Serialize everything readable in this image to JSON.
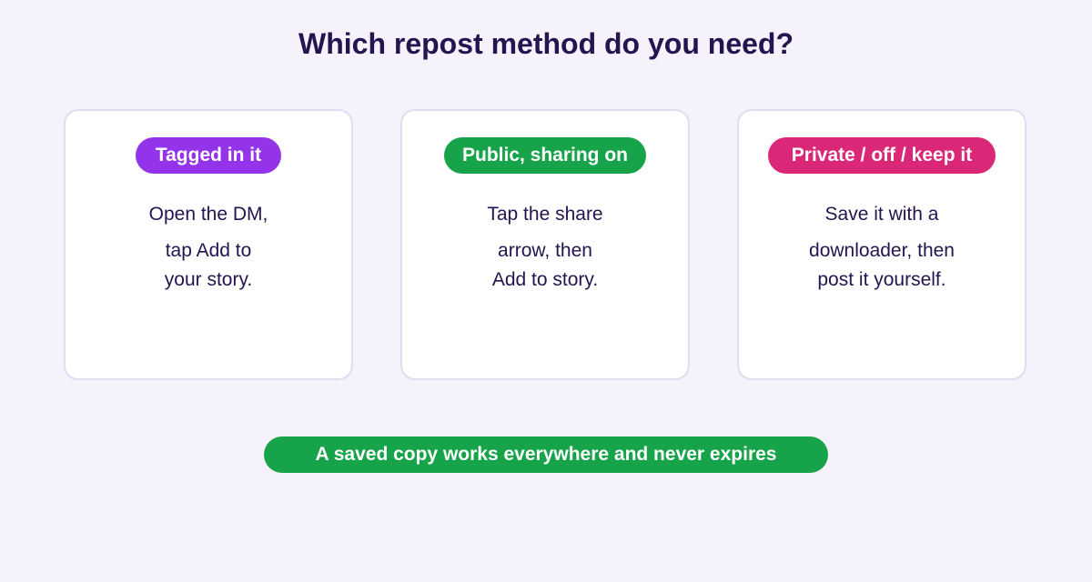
{
  "title": "Which repost method do you need?",
  "colors": {
    "background": "#f5f2fc",
    "text": "#24144f",
    "card_border": "#e2dcf2",
    "tagged": "#9333ea",
    "public": "#16a34a",
    "private": "#db2777",
    "footer": "#16a34a"
  },
  "cards": [
    {
      "label": "Tagged in it",
      "lines": [
        "Open the DM,",
        "tap Add to",
        "your story."
      ]
    },
    {
      "label": "Public, sharing on",
      "lines": [
        "Tap the share",
        "arrow, then",
        "Add to story."
      ]
    },
    {
      "label": "Private / off / keep it",
      "lines": [
        "Save it with a",
        "downloader, then",
        "post it yourself."
      ]
    }
  ],
  "footer": "A saved copy works everywhere and never expires"
}
